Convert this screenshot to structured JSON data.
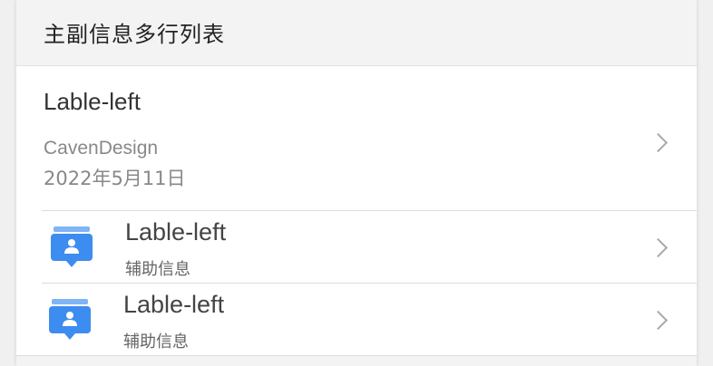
{
  "header": {
    "title": "主副信息多行列表"
  },
  "first_item": {
    "title": "Lable-left",
    "subtitle_line1": "CavenDesign",
    "subtitle_line2": "2022年5月11日"
  },
  "rows": [
    {
      "title": "Lable-left",
      "subtitle": "辅助信息",
      "icon": "contact-card-icon"
    },
    {
      "title": "Lable-left",
      "subtitle": "辅助信息",
      "icon": "contact-card-icon"
    }
  ],
  "colors": {
    "icon_blue": "#3d8cf0",
    "icon_blue_light": "#7fb4f6",
    "chevron": "#a9a9a9"
  }
}
